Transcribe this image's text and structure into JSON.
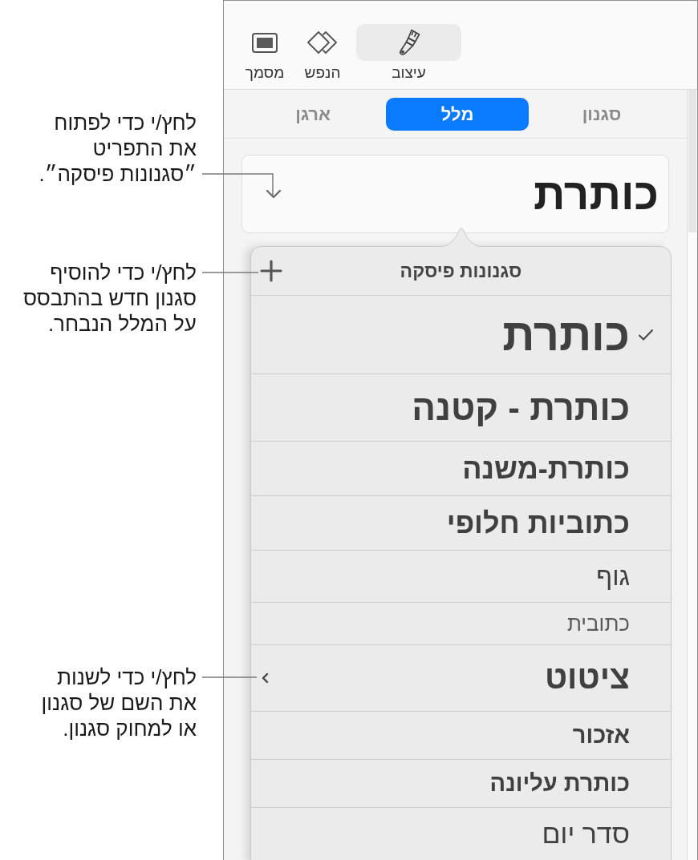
{
  "callouts": [
    {
      "lines": [
        "לחץ/י כדי לפתוח",
        "את התפריט",
        "״סגנונות פיסקה״."
      ]
    },
    {
      "lines": [
        "לחץ/י כדי להוסיף",
        "סגנון חדש בהתבסס",
        "על המלל הנבחר."
      ]
    },
    {
      "lines": [
        "לחץ/י כדי לשנות",
        "את השם של סגנון",
        "או למחוק סגנון."
      ]
    }
  ],
  "toolbar": {
    "items": [
      {
        "label": "עיצוב",
        "selected": true
      },
      {
        "label": "הנפש",
        "selected": false
      },
      {
        "label": "מסמך",
        "selected": false
      }
    ]
  },
  "tabs": [
    {
      "label": "סגנון",
      "selected": false
    },
    {
      "label": "מלל",
      "selected": true
    },
    {
      "label": "ארגן",
      "selected": false
    }
  ],
  "paragraph_style": {
    "value": "כותרת"
  },
  "popover": {
    "title": "סגנונות פיסקה",
    "styles": [
      {
        "label": "כותרת",
        "selected": true,
        "options_arrow": false
      },
      {
        "label": "כותרת - קטנה",
        "selected": false,
        "options_arrow": false
      },
      {
        "label": "כותרת-משנה",
        "selected": false,
        "options_arrow": false
      },
      {
        "label": "כתוביות חלופי",
        "selected": false,
        "options_arrow": false
      },
      {
        "label": "גוף",
        "selected": false,
        "options_arrow": false
      },
      {
        "label": "כתובית",
        "selected": false,
        "options_arrow": false
      },
      {
        "label": "ציטוט",
        "selected": false,
        "options_arrow": true
      },
      {
        "label": "אזכור",
        "selected": false,
        "options_arrow": false
      },
      {
        "label": "כותרת עליונה",
        "selected": false,
        "options_arrow": false
      },
      {
        "label": "סדר יום",
        "selected": false,
        "options_arrow": false
      }
    ]
  }
}
